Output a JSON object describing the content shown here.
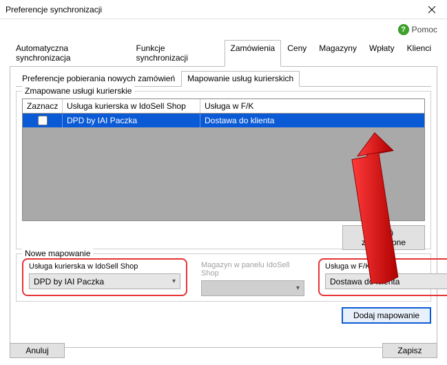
{
  "window": {
    "title": "Preferencje synchronizacji"
  },
  "help": {
    "label": "Pomoc"
  },
  "tabs": {
    "items": [
      "Automatyczna synchronizacja",
      "Funkcje synchronizacji",
      "Zamówienia",
      "Ceny",
      "Magazyny",
      "Wpłaty",
      "Klienci"
    ],
    "active_index": 2
  },
  "subtabs": {
    "items": [
      "Preferencje pobierania nowych zamówień",
      "Mapowanie usług kurierskich"
    ],
    "active_index": 1
  },
  "mapped_group": {
    "legend": "Zmapowane usługi kurierskie",
    "columns": {
      "c1": "Zaznacz",
      "c2": "Usługa kurierska w IdoSell Shop",
      "c3": "Usługa w F/K"
    },
    "rows": [
      {
        "checked": false,
        "service": "DPD by IAI Paczka",
        "fk": "Dostawa do klienta"
      }
    ],
    "delete_button": "Usuń zaznaczone"
  },
  "new_mapping": {
    "legend": "Nowe mapowanie",
    "col1_label": "Usługa kurierska w IdoSell Shop",
    "col1_value": "DPD by IAI Paczka",
    "col2_label": "Magazyn w panelu IdoSell Shop",
    "col2_value": "",
    "col3_label": "Usługa w F/K",
    "col3_value": "Dostawa do klienta",
    "add_button": "Dodaj mapowanie"
  },
  "footer": {
    "cancel": "Anuluj",
    "save": "Zapisz"
  },
  "colors": {
    "selection": "#0a5ad6",
    "arrow": "#e11",
    "highlight": "#e63232"
  }
}
